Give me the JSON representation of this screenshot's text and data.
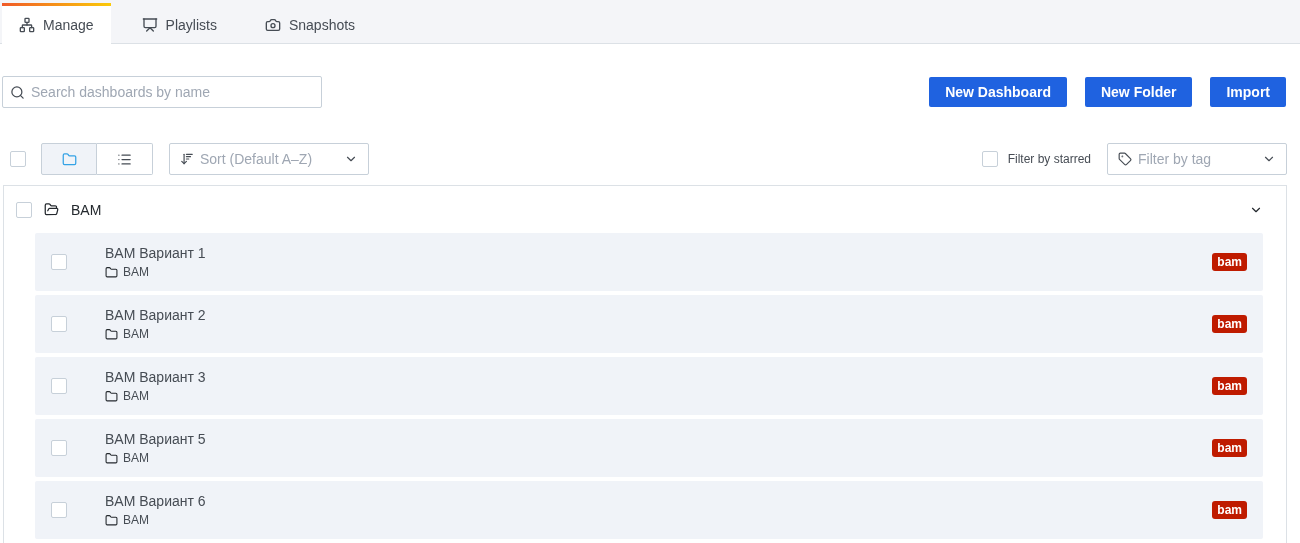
{
  "tabs": [
    {
      "label": "Manage",
      "selected": true
    },
    {
      "label": "Playlists",
      "selected": false
    },
    {
      "label": "Snapshots",
      "selected": false
    }
  ],
  "search": {
    "placeholder": "Search dashboards by name"
  },
  "actions": [
    "New Dashboard",
    "New Folder",
    "Import"
  ],
  "toolbar": {
    "select_all_checked": false,
    "view_modes": [
      {
        "kind": "folders",
        "selected": true
      },
      {
        "kind": "list",
        "selected": false
      }
    ],
    "sort": {
      "placeholder": "Sort (Default A–Z)"
    },
    "starred": {
      "label": "Filter by starred",
      "checked": false
    },
    "tag_filter": {
      "placeholder": "Filter by tag"
    }
  },
  "folder": {
    "name": "BAM",
    "checked": false,
    "expanded": true,
    "dashboards": [
      {
        "title": "BAM Вариант 1",
        "folder": "BAM",
        "tag": "bam",
        "checked": false
      },
      {
        "title": "BAM Вариант 2",
        "folder": "BAM",
        "tag": "bam",
        "checked": false
      },
      {
        "title": "BAM Вариант 3",
        "folder": "BAM",
        "tag": "bam",
        "checked": false
      },
      {
        "title": "BAM Вариант 5",
        "folder": "BAM",
        "tag": "bam",
        "checked": false
      },
      {
        "title": "BAM Вариант 6",
        "folder": "BAM",
        "tag": "bam",
        "checked": false
      }
    ]
  }
}
